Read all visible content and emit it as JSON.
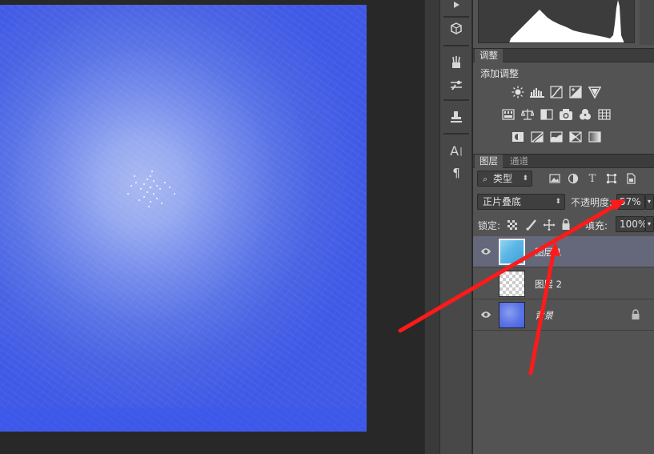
{
  "adjustments_panel": {
    "tab_label": "调整",
    "title": "添加调整"
  },
  "layers_panel": {
    "tabs": [
      "图层",
      "通道"
    ],
    "filter": {
      "label": "类型"
    },
    "blend_mode": "正片叠底",
    "opacity": {
      "label": "不透明度:",
      "value": "57%"
    },
    "lock": {
      "label": "锁定:"
    },
    "fill": {
      "label": "填充:",
      "value": "100%"
    },
    "layers": [
      {
        "name": "图层 1",
        "selected": true,
        "visible": true
      },
      {
        "name": "图层 2",
        "selected": false,
        "visible": false
      },
      {
        "name": "背景",
        "selected": false,
        "visible": true,
        "locked": true
      }
    ]
  },
  "icons": [
    "play-icon",
    "3d-cube-icon",
    "brushes-icon",
    "brush-settings-icon",
    "clone-source-icon",
    "character-icon",
    "paragraph-icon",
    "brightness-contrast-icon",
    "levels-icon",
    "curves-icon",
    "exposure-icon",
    "vibrance-icon",
    "hue-saturation-icon",
    "color-balance-icon",
    "black-white-icon",
    "photo-filter-icon",
    "channel-mixer-icon",
    "color-lookup-icon",
    "invert-icon",
    "posterize-icon",
    "threshold-icon",
    "selective-color-icon",
    "gradient-map-icon",
    "search-icon",
    "image-filter-icon",
    "adjustment-filter-icon",
    "type-filter-icon",
    "shape-filter-icon",
    "smart-object-filter-icon",
    "lock-pixels-icon",
    "lock-brush-icon",
    "lock-position-icon",
    "lock-all-icon",
    "eye-icon",
    "lock-icon"
  ],
  "colors": {
    "canvas_blue": "#3f58e6",
    "selected_layer": "#64687a",
    "annotation_arrow": "#ff1a1a"
  }
}
